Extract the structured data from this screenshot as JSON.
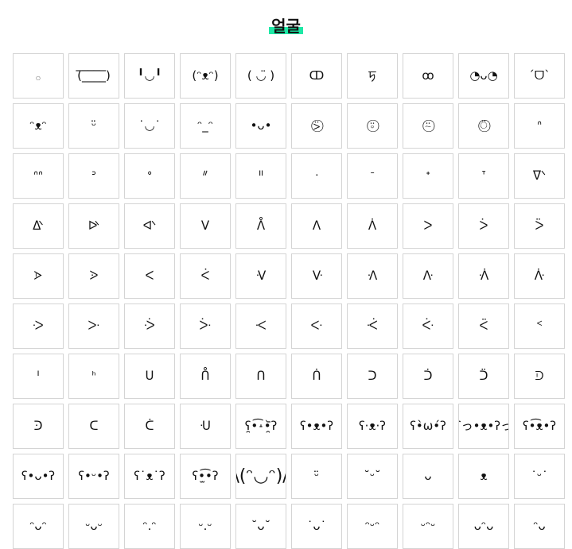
{
  "page": {
    "title": "얼굴"
  },
  "emoticons": [
    "𓂂",
    "(̅_̅̅_̅̅_̅̅_̅)",
    "╹◡╹",
    "(ᵔᴥᵔ)",
    "( ◡̈ )",
    "ↀ",
    "ꠠ",
    "ꝏ",
    "◔ᴗ◔",
    "ˊᗜˋ",
    "ᵔᴥᵔ",
    "ᵕ̈",
    "˙◡˙",
    "ᵔ_ᵔ",
    "•ᴗ•",
    "⍩⃝",
    "⍤⃝",
    "⍨⃝",
    "⍥⃝",
    "ᐢ",
    "ᐢᐢ",
    "ᐣ",
    "ᐤ",
    "ᐥ",
    "ᐦ",
    "ᐧ",
    "ᐨ",
    "ᐩ",
    "ᐪ",
    "ᐫ",
    "ᐬ",
    "ᐭ",
    "ᐮ",
    "ᐯ",
    "ᐰ",
    "ᐱ",
    "ᐲ",
    "ᐳ",
    "ᐴ",
    "ᐵ",
    "ᐶ",
    "ᐷ",
    "ᐸ",
    "ᐹ",
    "ᐺ",
    "ᐻ",
    "ᐼ",
    "ᐽ",
    "ᐾ",
    "ᐿ",
    "ᑀ",
    "ᑁ",
    "ᑂ",
    "ᑃ",
    "ᑄ",
    "ᑅ",
    "ᑆ",
    "ᑇ",
    "ᑈ",
    "ᑉ",
    "ᑊ",
    "ᑋ",
    "ᑌ",
    "ᑍ",
    "ᑎ",
    "ᑏ",
    "ᑐ",
    "ᑑ",
    "ᑒ",
    "ᑓ",
    "ᑔ",
    "ᑕ",
    "ᑖ",
    "ᑗ",
    "ʕ̯•͡˔•̯᷅ʔ",
    "ʕ•ᴥ•ʔ",
    "ʕ·ᴥ·ʔ",
    "ʕ•̀ω•́ʔ",
    "ʕっ•ᴥ•ʔっ",
    "ʕ•͡ᴥ•ʔ",
    "ʕ•ᴗ•ʔ",
    "ʕ•ᵕ•ʔ",
    "ʕ˙ᴥ˙ʔ",
    "ʕ•̫͡•ʔ",
    "\\(ᵔ◡ᵔ)/",
    "ᵕ̈",
    "˘ᵕ˘",
    "ᴗ",
    "ᴥ",
    "˙ᵕ˙",
    "ᵔᴗᵔ",
    "ᵕᴗᵕ",
    "ᵔ.ᵔ",
    "ᵕ.ᵕ",
    "˘ᴗ˘",
    "˙ᴗ˙",
    "ᵔᵕᵔ",
    "ᵕᵔᵕ",
    "ᴗᵔᴗ",
    "ᵔᴗ"
  ]
}
